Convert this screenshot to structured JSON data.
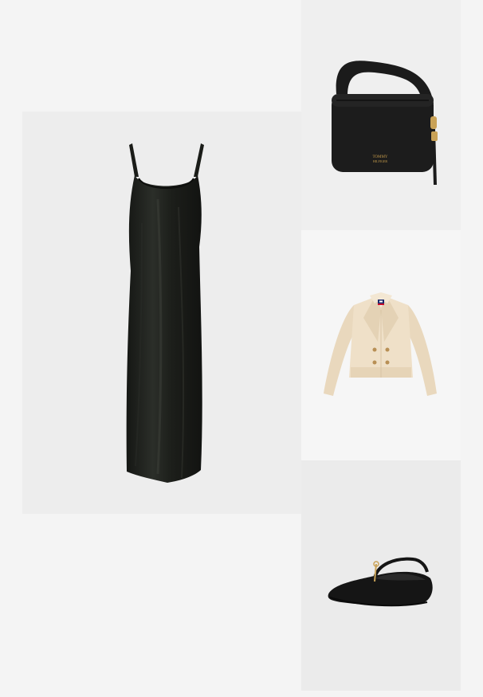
{
  "outfit": {
    "items": [
      {
        "id": "dress",
        "icon": "slip-dress-image",
        "color": "#1f211d"
      },
      {
        "id": "bag",
        "icon": "handbag-image",
        "color": "#1c1c1c",
        "logo_text": [
          "TOMMY",
          "HILFIGER"
        ],
        "logo_color": "#c49a4a"
      },
      {
        "id": "jacket",
        "icon": "cropped-trench-jacket-image",
        "color": "#efe0c8"
      },
      {
        "id": "shoe",
        "icon": "ballet-flat-image",
        "color": "#151515"
      }
    ]
  },
  "colors": {
    "page_background": "#f4f4f4",
    "hardware_gold": "#c9a257"
  }
}
